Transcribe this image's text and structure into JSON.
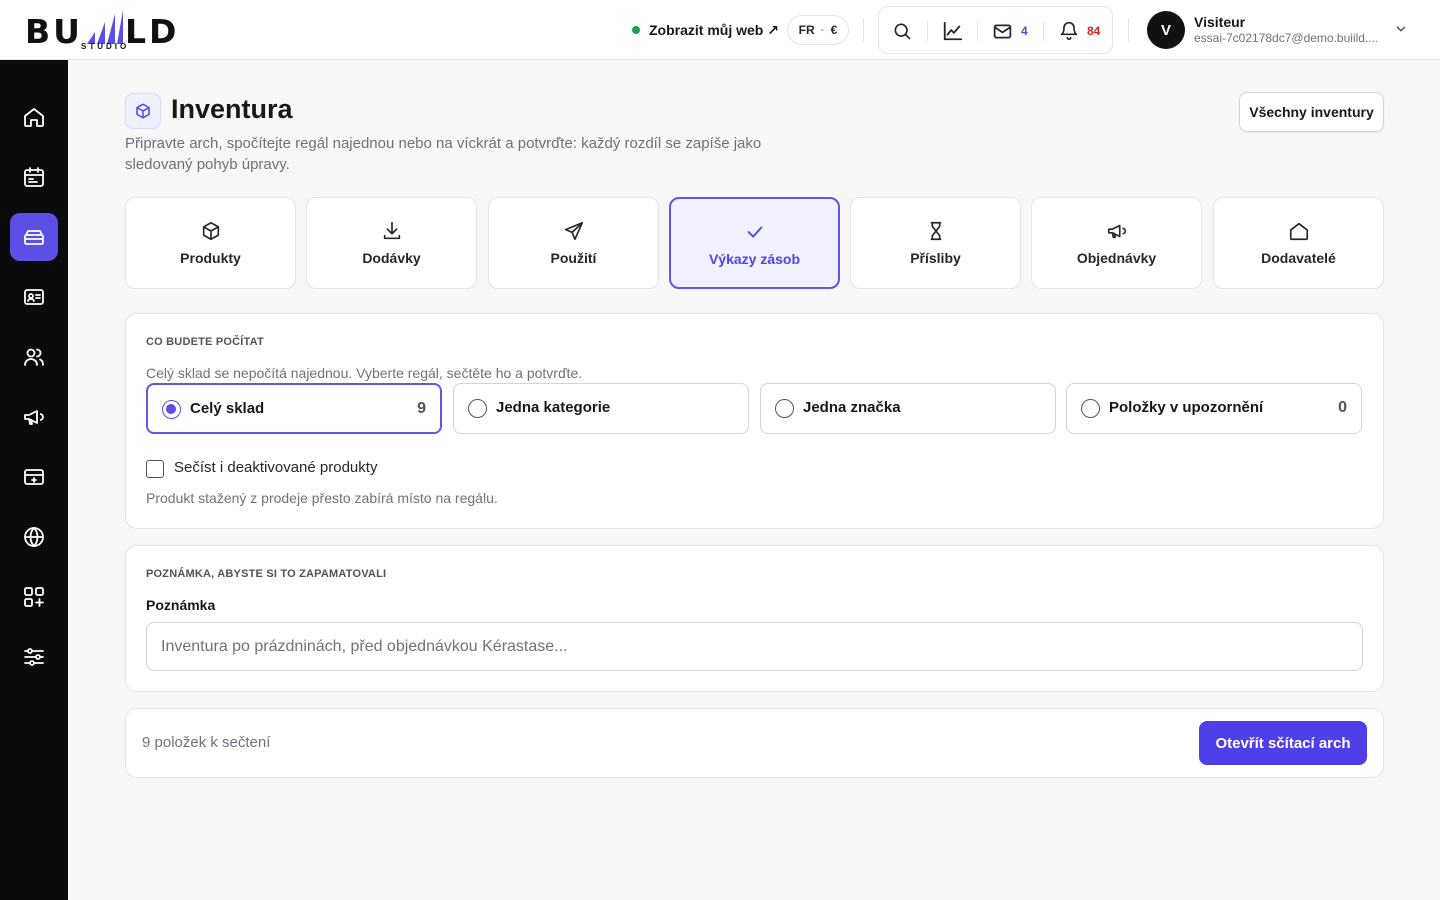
{
  "brand": {
    "logo_left": "BU",
    "logo_right": "LD",
    "logo_sub": "STUDIO"
  },
  "header": {
    "site_link": "Zobrazit můj web ↗",
    "lang": "FR",
    "currency": "€",
    "mail_count": "4",
    "notif_count": "84",
    "user_initial": "V",
    "user_name": "Visiteur",
    "user_email": "essai-7c02178dc7@demo.buiild...."
  },
  "colors": {
    "accent": "#5b4fe6",
    "mail_badge": "#4f46e5",
    "notif_badge": "#dc2626",
    "status_dot": "#16a34a"
  },
  "page": {
    "title": "Inventura",
    "description": "Připravte arch, spočítejte regál najednou nebo na víckrát a potvrďte: každý rozdíl se zapíše jako sledovaný pohyb úpravy.",
    "all_button": "Všechny inventury"
  },
  "tabs": [
    {
      "label": "Produkty",
      "icon": "box-icon"
    },
    {
      "label": "Dodávky",
      "icon": "download-icon"
    },
    {
      "label": "Použití",
      "icon": "send-icon"
    },
    {
      "label": "Výkazy zásob",
      "icon": "check-icon"
    },
    {
      "label": "Přísliby",
      "icon": "hourglass-icon"
    },
    {
      "label": "Objednávky",
      "icon": "megaphone-icon"
    },
    {
      "label": "Dodavatelé",
      "icon": "home-icon"
    }
  ],
  "scope": {
    "title": "Co budete počítat",
    "description": "Celý sklad se nepočítá najednou. Vyberte regál, sečtěte ho a potvrďte.",
    "options": [
      {
        "label": "Celý sklad",
        "count": "9"
      },
      {
        "label": "Jedna kategorie",
        "count": ""
      },
      {
        "label": "Jedna značka",
        "count": ""
      },
      {
        "label": "Položky v upozornění",
        "count": "0"
      }
    ],
    "checkbox_label": "Sečíst i deaktivované produkty",
    "checkbox_help": "Produkt stažený z prodeje přesto zabírá místo na regálu."
  },
  "note": {
    "title": "Poznámka, abyste si to zapamatovali",
    "label": "Poznámka",
    "placeholder": "Inventura po prázdninách, před objednávkou Kérastase..."
  },
  "footer": {
    "count_text": "9 položek k sečtení",
    "open_button": "Otevřít sčítací arch"
  },
  "sidebar": [
    {
      "icon": "home-icon"
    },
    {
      "icon": "calendar-icon"
    },
    {
      "icon": "inventory-icon"
    },
    {
      "icon": "contact-card-icon"
    },
    {
      "icon": "users-icon"
    },
    {
      "icon": "megaphone-icon"
    },
    {
      "icon": "register-icon"
    },
    {
      "icon": "globe-icon"
    },
    {
      "icon": "apps-icon"
    },
    {
      "icon": "sliders-icon"
    }
  ]
}
